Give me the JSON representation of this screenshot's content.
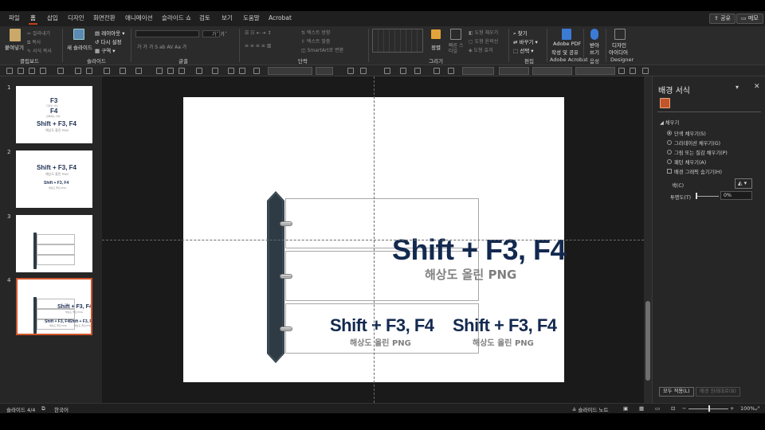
{
  "menu": {
    "tabs": [
      "파일",
      "홈",
      "삽입",
      "디자인",
      "화면전환",
      "애니메이션",
      "슬라이드 쇼",
      "검토",
      "보기",
      "도움말",
      "Acrobat"
    ],
    "active_tab": "홈",
    "share_label": "공유",
    "memo_label": "메모"
  },
  "ribbon": {
    "groups": [
      "클립보드",
      "슬라이드",
      "글꼴",
      "단락",
      "그리기",
      "편집",
      "Adobe Acrobat",
      "음성",
      "Designer"
    ],
    "paste_label": "붙여넣기",
    "new_slide_label": "새 슬라이드",
    "layout_label": "레이아웃",
    "reset_label": "다시 설정",
    "section_label": "구역",
    "clipboard_cut": "잘라내기",
    "clipboard_copy": "복사",
    "clipboard_format": "서식 복사",
    "text_direction": "텍스트 방향",
    "text_align": "텍스트 맞춤",
    "smartart": "SmartArt로 변환",
    "arrange_label": "정렬",
    "quick_style_label": "빠른 스타일",
    "shape_fill": "도형 채우기",
    "shape_outline": "도형 윤곽선",
    "shape_effect": "도형 효과",
    "find_label": "찾기",
    "replace_label": "바꾸기",
    "select_label": "선택",
    "adobe_label_1": "Adobe PDF",
    "adobe_label_2": "작성 및 공유",
    "dictate_label_1": "받아",
    "dictate_label_2": "쓰기",
    "designer_label_1": "디자인",
    "designer_label_2": "아이디어"
  },
  "slides": {
    "numbers": [
      "1",
      "2",
      "3",
      "4"
    ],
    "t1_line1": "F3",
    "t1_line1_sub": "디자인 서식",
    "t1_line2": "F4",
    "t1_line2_sub": "반복되는 서식",
    "t1_line3": "Shift + F3, F4",
    "t1_line3_sub": "해상도 올린 PNG",
    "t2_line1": "Shift + F3, F4",
    "t2_line1_sub": "해상도 올린 PNG",
    "t2_line2": "Shift + F3, F4",
    "t2_line2_sub": "해상도 올린 PNG"
  },
  "main_slide": {
    "title_big": "Shift + F3, F4",
    "title_sub": "해상도 올린 PNG",
    "left_big": "Shift + F3, F4",
    "left_sub": "해상도 올린 PNG",
    "right_big": "Shift + F3, F4",
    "right_sub": "해상도 올린 PNG"
  },
  "format_pane": {
    "title": "배경 서식",
    "section": "채우기",
    "options": [
      "단색 채우기(S)",
      "그라데이션 채우기(G)",
      "그림 또는 질감 채우기(P)",
      "패턴 채우기(A)"
    ],
    "hide_graphics": "배경 그래픽 숨기기(H)",
    "color_label": "색(C)",
    "transparency_label": "투명도(T)",
    "transparency_value": "0%",
    "apply_all": "모두 적용(L)",
    "reset_bg": "배경 원래대로(B)"
  },
  "status": {
    "slide_info": "슬라이드 4/4",
    "language": "한국어",
    "notes": "슬라이드 노트",
    "zoom": "100%"
  },
  "colors": {
    "accent": "#c43e1c",
    "title_navy": "#13294f",
    "binder": "#2e3b44"
  }
}
